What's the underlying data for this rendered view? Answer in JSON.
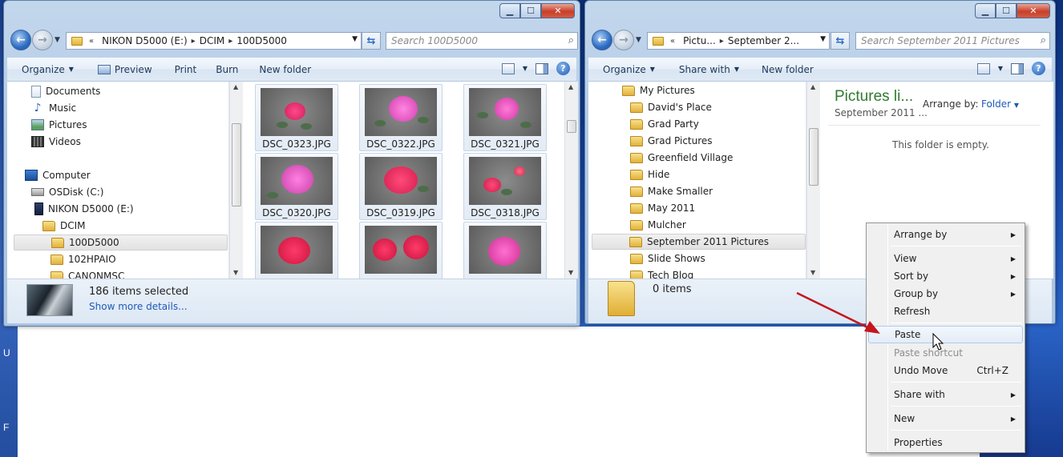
{
  "left_edge": {
    "glyph_a": "U",
    "glyph_b": "F"
  },
  "left_window": {
    "address": {
      "prefix": "«",
      "segments": [
        "NIKON D5000 (E:)",
        "DCIM",
        "100D5000"
      ]
    },
    "search_placeholder": "Search 100D5000",
    "toolbar": {
      "organize": "Organize",
      "preview": "Preview",
      "print": "Print",
      "burn": "Burn",
      "new_folder": "New folder"
    },
    "nav": {
      "documents": "Documents",
      "music": "Music",
      "pictures": "Pictures",
      "videos": "Videos",
      "computer": "Computer",
      "osdisk": "OSDisk (C:)",
      "nikon": "NIKON D5000 (E:)",
      "dcim": "DCIM",
      "f100d5000": "100D5000",
      "f102hpaio": "102HPAIO",
      "canonmsc": "CANONMSC"
    },
    "thumbnails": [
      "DSC_0323.JPG",
      "DSC_0322.JPG",
      "DSC_0321.JPG",
      "DSC_0320.JPG",
      "DSC_0319.JPG",
      "DSC_0318.JPG",
      "",
      "",
      ""
    ],
    "details": {
      "count": "186 items selected",
      "more": "Show more details..."
    }
  },
  "right_window": {
    "address": {
      "prefix": "«",
      "segments": [
        "Pictu...",
        "September 2..."
      ]
    },
    "search_placeholder": "Search September 2011 Pictures",
    "toolbar": {
      "organize": "Organize",
      "share_with": "Share with",
      "new_folder": "New folder"
    },
    "nav": {
      "my_pictures": "My Pictures",
      "folders": [
        "David's Place",
        "Grad Party",
        "Grad Pictures",
        "Greenfield Village",
        "Hide",
        "Make Smaller",
        "May 2011",
        "Mulcher",
        "September 2011 Pictures",
        "Slide Shows",
        "Tech Blog"
      ]
    },
    "library": {
      "title": "Pictures li...",
      "subtitle": "September 2011 ...",
      "arrange_label": "Arrange by:",
      "arrange_value": "Folder",
      "empty": "This folder is empty."
    },
    "details": {
      "count": "0 items"
    }
  },
  "context_menu": {
    "arrange_by": "Arrange by",
    "view": "View",
    "sort_by": "Sort by",
    "group_by": "Group by",
    "refresh": "Refresh",
    "paste": "Paste",
    "paste_shortcut": "Paste shortcut",
    "undo_move": "Undo Move",
    "undo_key": "Ctrl+Z",
    "share_with": "Share with",
    "new": "New",
    "properties": "Properties"
  },
  "colors": {
    "annotation_arrow": "#c4161c",
    "library_title": "#2f7a2f",
    "link": "#1c5bb8"
  }
}
